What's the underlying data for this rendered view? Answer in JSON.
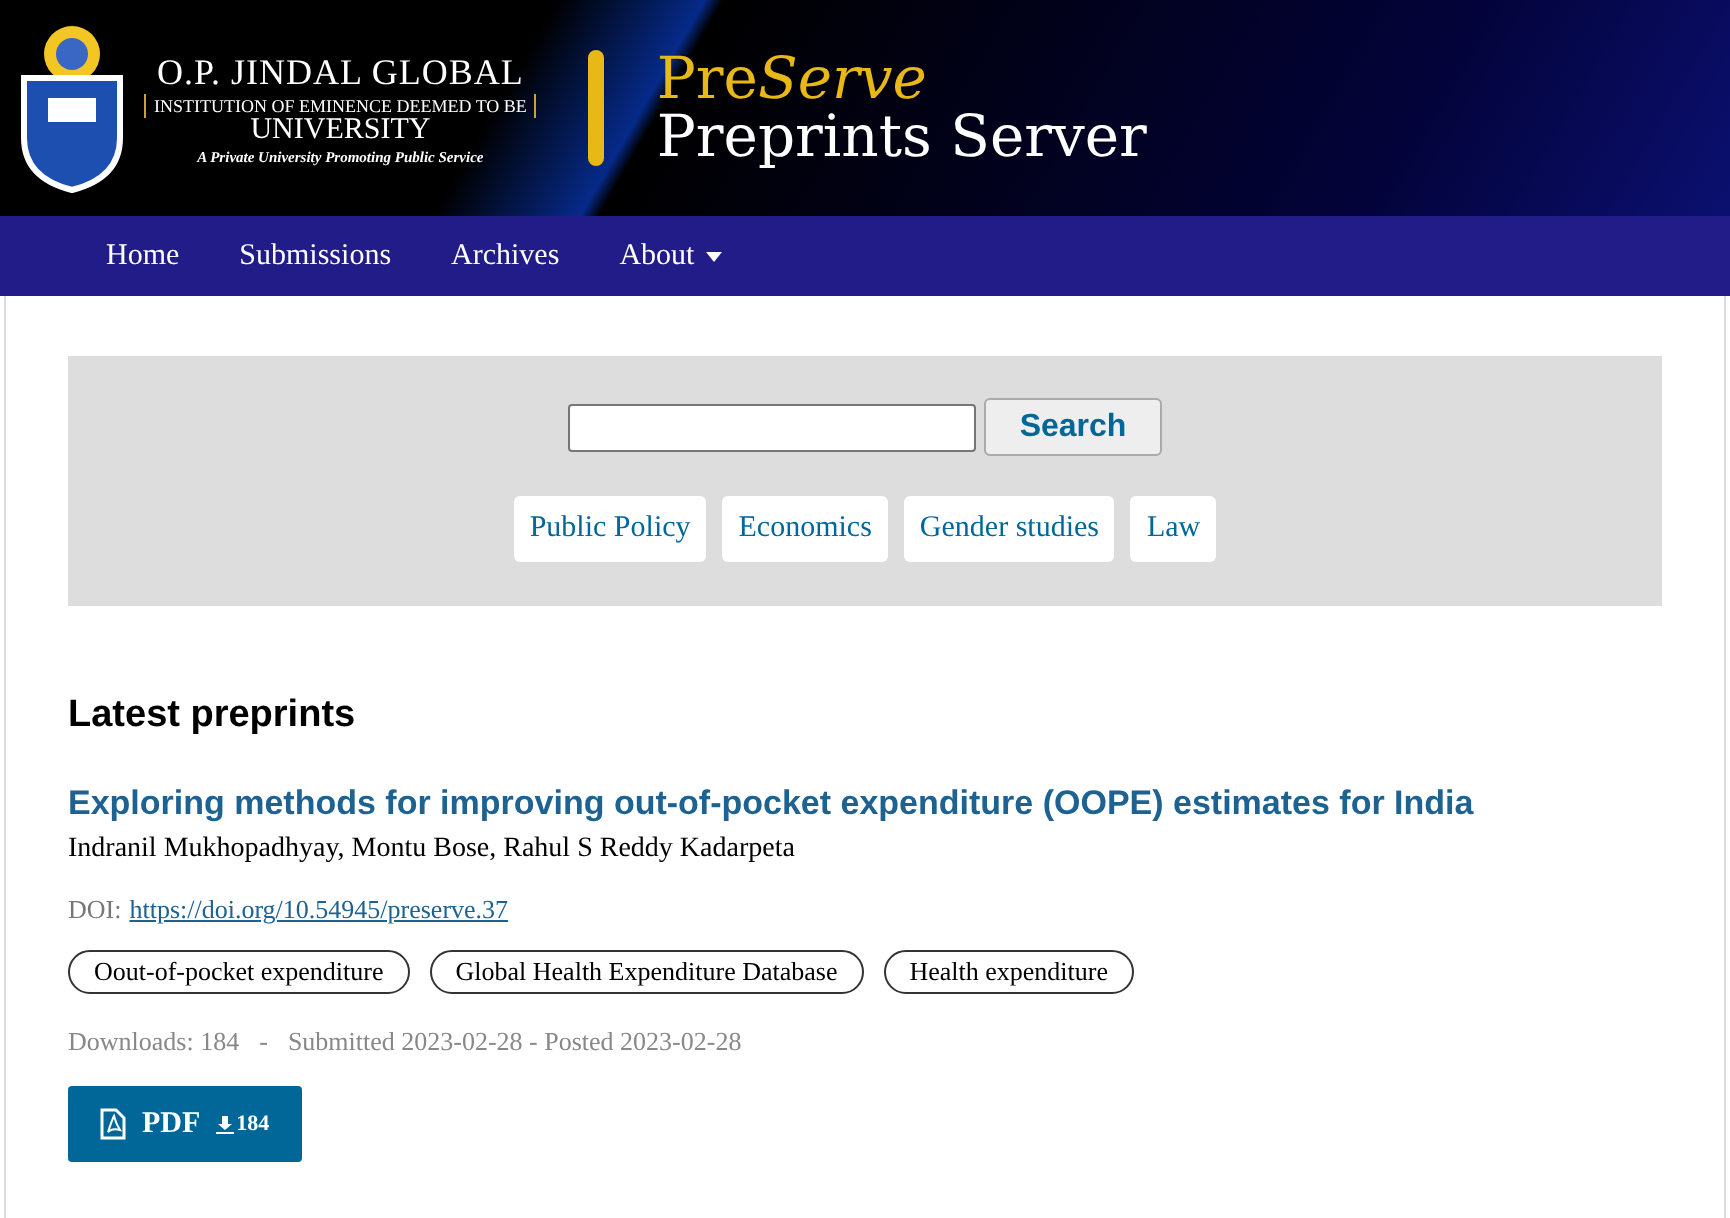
{
  "header": {
    "logo_lines": [
      "O.P. JINDAL GLOBAL",
      "INSTITUTION OF EMINENCE DEEMED TO BE",
      "UNIVERSITY",
      "A Private University Promoting Public Service"
    ],
    "brand": "Pre",
    "brand_italic": "Serve",
    "subtitle": "Preprints Server"
  },
  "nav": [
    {
      "label": "Home",
      "dropdown": false
    },
    {
      "label": "Submissions",
      "dropdown": false
    },
    {
      "label": "Archives",
      "dropdown": false
    },
    {
      "label": "About",
      "dropdown": true
    }
  ],
  "search": {
    "button": "Search",
    "categories": [
      "Public Policy",
      "Economics",
      "Gender studies",
      "Law"
    ]
  },
  "section_title": "Latest preprints",
  "preprints": [
    {
      "title": "Exploring methods for improving out-of-pocket expenditure (OOPE) estimates for India",
      "authors": "Indranil Mukhopadhyay, Montu Bose, Rahul S Reddy Kadarpeta",
      "doi_label": "DOI:",
      "doi": "https://doi.org/10.54945/preserve.37",
      "keywords": [
        "Oout-of-pocket expenditure",
        "Global Health Expenditure Database",
        "Health expenditure"
      ],
      "downloads": "Downloads: 184",
      "separator": "-",
      "dates": "Submitted 2023-02-28 - Posted 2023-02-28",
      "pdf_label": "PDF",
      "pdf_count": "184"
    }
  ]
}
